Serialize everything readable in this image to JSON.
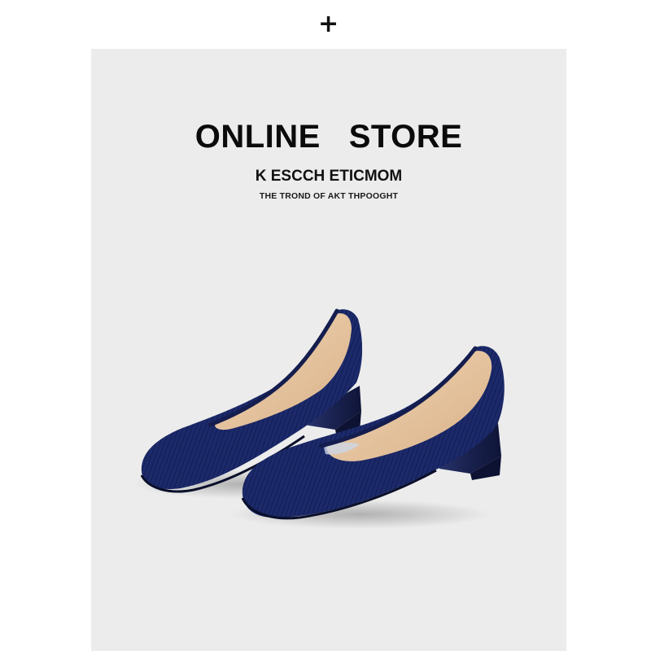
{
  "header": {
    "plus_symbol": "+",
    "plus_icon": "plus-icon"
  },
  "banner": {
    "title": "ONLINE   STORE",
    "subtitle": "K ESCCH ETICMOM",
    "tagline": "THE TROND OF AKT THPOOGHT"
  },
  "product": {
    "description_icon": "shoes-image",
    "shoe_color": "#1c2a6b",
    "lining_color": "#e8c9a6",
    "background_color": "#ececec"
  }
}
